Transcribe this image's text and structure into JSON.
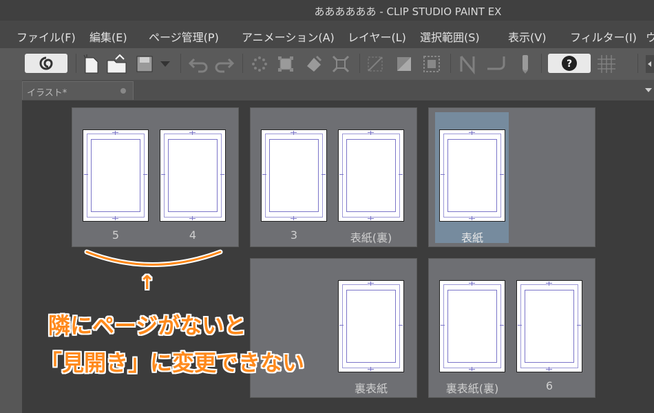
{
  "window": {
    "title": "ああああああ - CLIP STUDIO PAINT EX"
  },
  "menu": [
    "ファイル(F)",
    "編集(E)",
    "ページ管理(P)",
    "アニメーション(A)",
    "レイヤー(L)",
    "選択範囲(S)",
    "表示(V)",
    "フィルター(I)",
    "ウ"
  ],
  "toolbar": {
    "icons": [
      "clip-studio-logo-icon",
      "new-file-icon",
      "open-file-icon",
      "save-icon",
      "save-dropdown-icon",
      "undo-icon",
      "redo-icon",
      "clear-selection-icon",
      "transform-icon",
      "fill-icon",
      "scale-icon",
      "deselect-icon",
      "invert-selection-icon",
      "selection-area-icon",
      "ruler-icon",
      "border-icon",
      "pen-icon",
      "help-icon",
      "grid-icon"
    ]
  },
  "tabs": [
    {
      "label": "イラスト*"
    }
  ],
  "spreads": [
    {
      "pages": [
        "5",
        "4"
      ]
    },
    {
      "pages": [
        "3",
        "表紙(裏)"
      ]
    },
    {
      "pages": [
        "表紙"
      ]
    },
    {
      "pages": [
        "裏表紙"
      ]
    },
    {
      "pages": [
        "裏表紙(裏)",
        "6"
      ]
    }
  ],
  "annotation": {
    "line1": "隣にページがないと",
    "line2": "「見開き」に変更できない",
    "arrow": "↑",
    "color": "#ff8a1c"
  }
}
